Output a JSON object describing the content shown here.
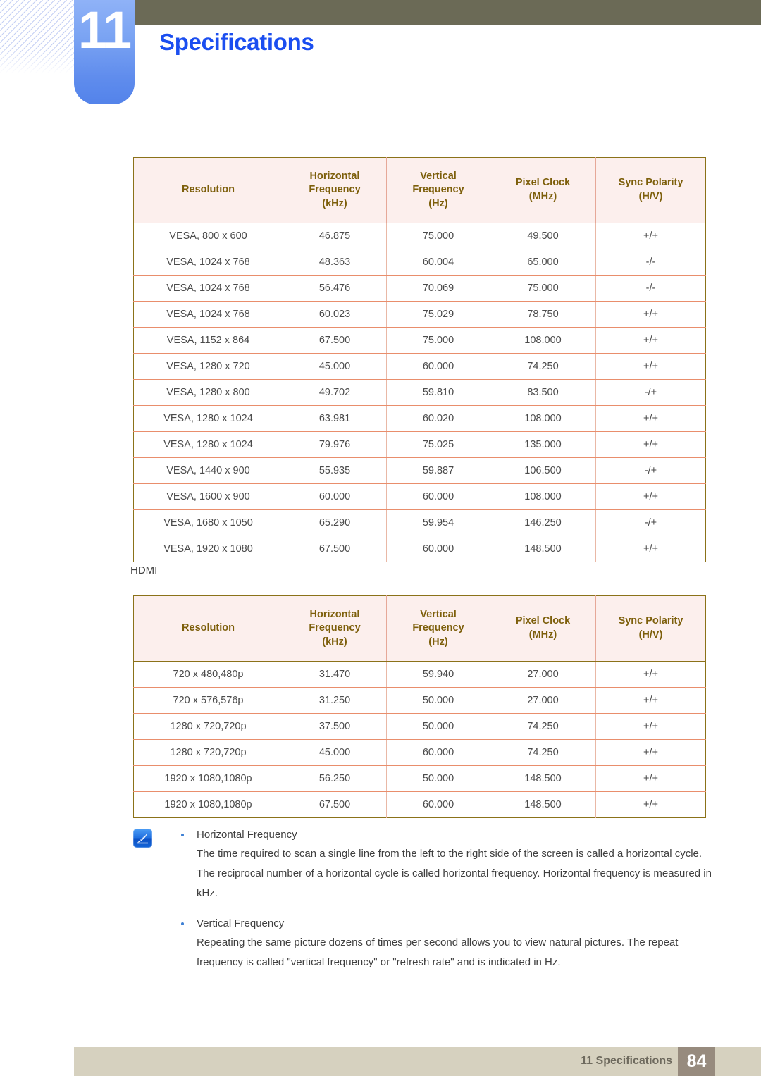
{
  "header": {
    "chapter_number": "11",
    "chapter_title": "Specifications"
  },
  "tables": [
    {
      "name": "vesa-timing-table",
      "caption": "",
      "columns": [
        "Resolution",
        "Horizontal\nFrequency\n(kHz)",
        "Vertical\nFrequency\n(Hz)",
        "Pixel Clock\n(MHz)",
        "Sync Polarity\n(H/V)"
      ],
      "columns_lines": [
        [
          "Resolution"
        ],
        [
          "Horizontal",
          "Frequency",
          "(kHz)"
        ],
        [
          "Vertical",
          "Frequency",
          "(Hz)"
        ],
        [
          "Pixel Clock",
          "(MHz)"
        ],
        [
          "Sync Polarity",
          "(H/V)"
        ]
      ],
      "rows": [
        [
          "VESA, 800 x 600",
          "46.875",
          "75.000",
          "49.500",
          "+/+"
        ],
        [
          "VESA, 1024 x 768",
          "48.363",
          "60.004",
          "65.000",
          "-/-"
        ],
        [
          "VESA, 1024 x 768",
          "56.476",
          "70.069",
          "75.000",
          "-/-"
        ],
        [
          "VESA, 1024 x 768",
          "60.023",
          "75.029",
          "78.750",
          "+/+"
        ],
        [
          "VESA, 1152 x 864",
          "67.500",
          "75.000",
          "108.000",
          "+/+"
        ],
        [
          "VESA, 1280 x 720",
          "45.000",
          "60.000",
          "74.250",
          "+/+"
        ],
        [
          "VESA, 1280 x 800",
          "49.702",
          "59.810",
          "83.500",
          "-/+"
        ],
        [
          "VESA, 1280 x 1024",
          "63.981",
          "60.020",
          "108.000",
          "+/+"
        ],
        [
          "VESA, 1280 x 1024",
          "79.976",
          "75.025",
          "135.000",
          "+/+"
        ],
        [
          "VESA, 1440 x 900",
          "55.935",
          "59.887",
          "106.500",
          "-/+"
        ],
        [
          "VESA, 1600 x 900",
          "60.000",
          "60.000",
          "108.000",
          "+/+"
        ],
        [
          "VESA, 1680 x 1050",
          "65.290",
          "59.954",
          "146.250",
          "-/+"
        ],
        [
          "VESA, 1920 x 1080",
          "67.500",
          "60.000",
          "148.500",
          "+/+"
        ]
      ]
    },
    {
      "name": "hdmi-timing-table",
      "caption": "HDMI",
      "columns_lines": [
        [
          "Resolution"
        ],
        [
          "Horizontal",
          "Frequency",
          "(kHz)"
        ],
        [
          "Vertical",
          "Frequency",
          "(Hz)"
        ],
        [
          "Pixel Clock",
          "(MHz)"
        ],
        [
          "Sync Polarity",
          "(H/V)"
        ]
      ],
      "rows": [
        [
          "720 x 480,480p",
          "31.470",
          "59.940",
          "27.000",
          "+/+"
        ],
        [
          "720 x 576,576p",
          "31.250",
          "50.000",
          "27.000",
          "+/+"
        ],
        [
          "1280 x 720,720p",
          "37.500",
          "50.000",
          "74.250",
          "+/+"
        ],
        [
          "1280 x 720,720p",
          "45.000",
          "60.000",
          "74.250",
          "+/+"
        ],
        [
          "1920 x 1080,1080p",
          "56.250",
          "50.000",
          "148.500",
          "+/+"
        ],
        [
          "1920 x 1080,1080p",
          "67.500",
          "60.000",
          "148.500",
          "+/+"
        ]
      ]
    }
  ],
  "note": {
    "icon": "note-pen-icon",
    "items": [
      {
        "term": "Horizontal Frequency",
        "body": "The time required to scan a single line from the left to the right side of the screen is called a horizontal cycle. The reciprocal number of a horizontal cycle is called horizontal frequency. Horizontal frequency is measured in kHz."
      },
      {
        "term": "Vertical Frequency",
        "body": "Repeating the same picture dozens of times per second allows you to view natural pictures. The repeat frequency is called \"vertical frequency\" or \"refresh rate\" and is indicated in Hz."
      }
    ]
  },
  "footer": {
    "label": "11 Specifications",
    "page_number": "84"
  },
  "colors": {
    "header_bar": "#6b6a56",
    "badge_blue": "#5f8ced",
    "title_blue": "#1b4ef0",
    "table_header_bg": "#fcefed",
    "table_header_text": "#7d5f0b",
    "table_border_outer": "#8b7219",
    "table_border_inner": "#e98e6c",
    "footer_bg": "#d6d1bf",
    "footer_page_bg": "#978b7e"
  }
}
